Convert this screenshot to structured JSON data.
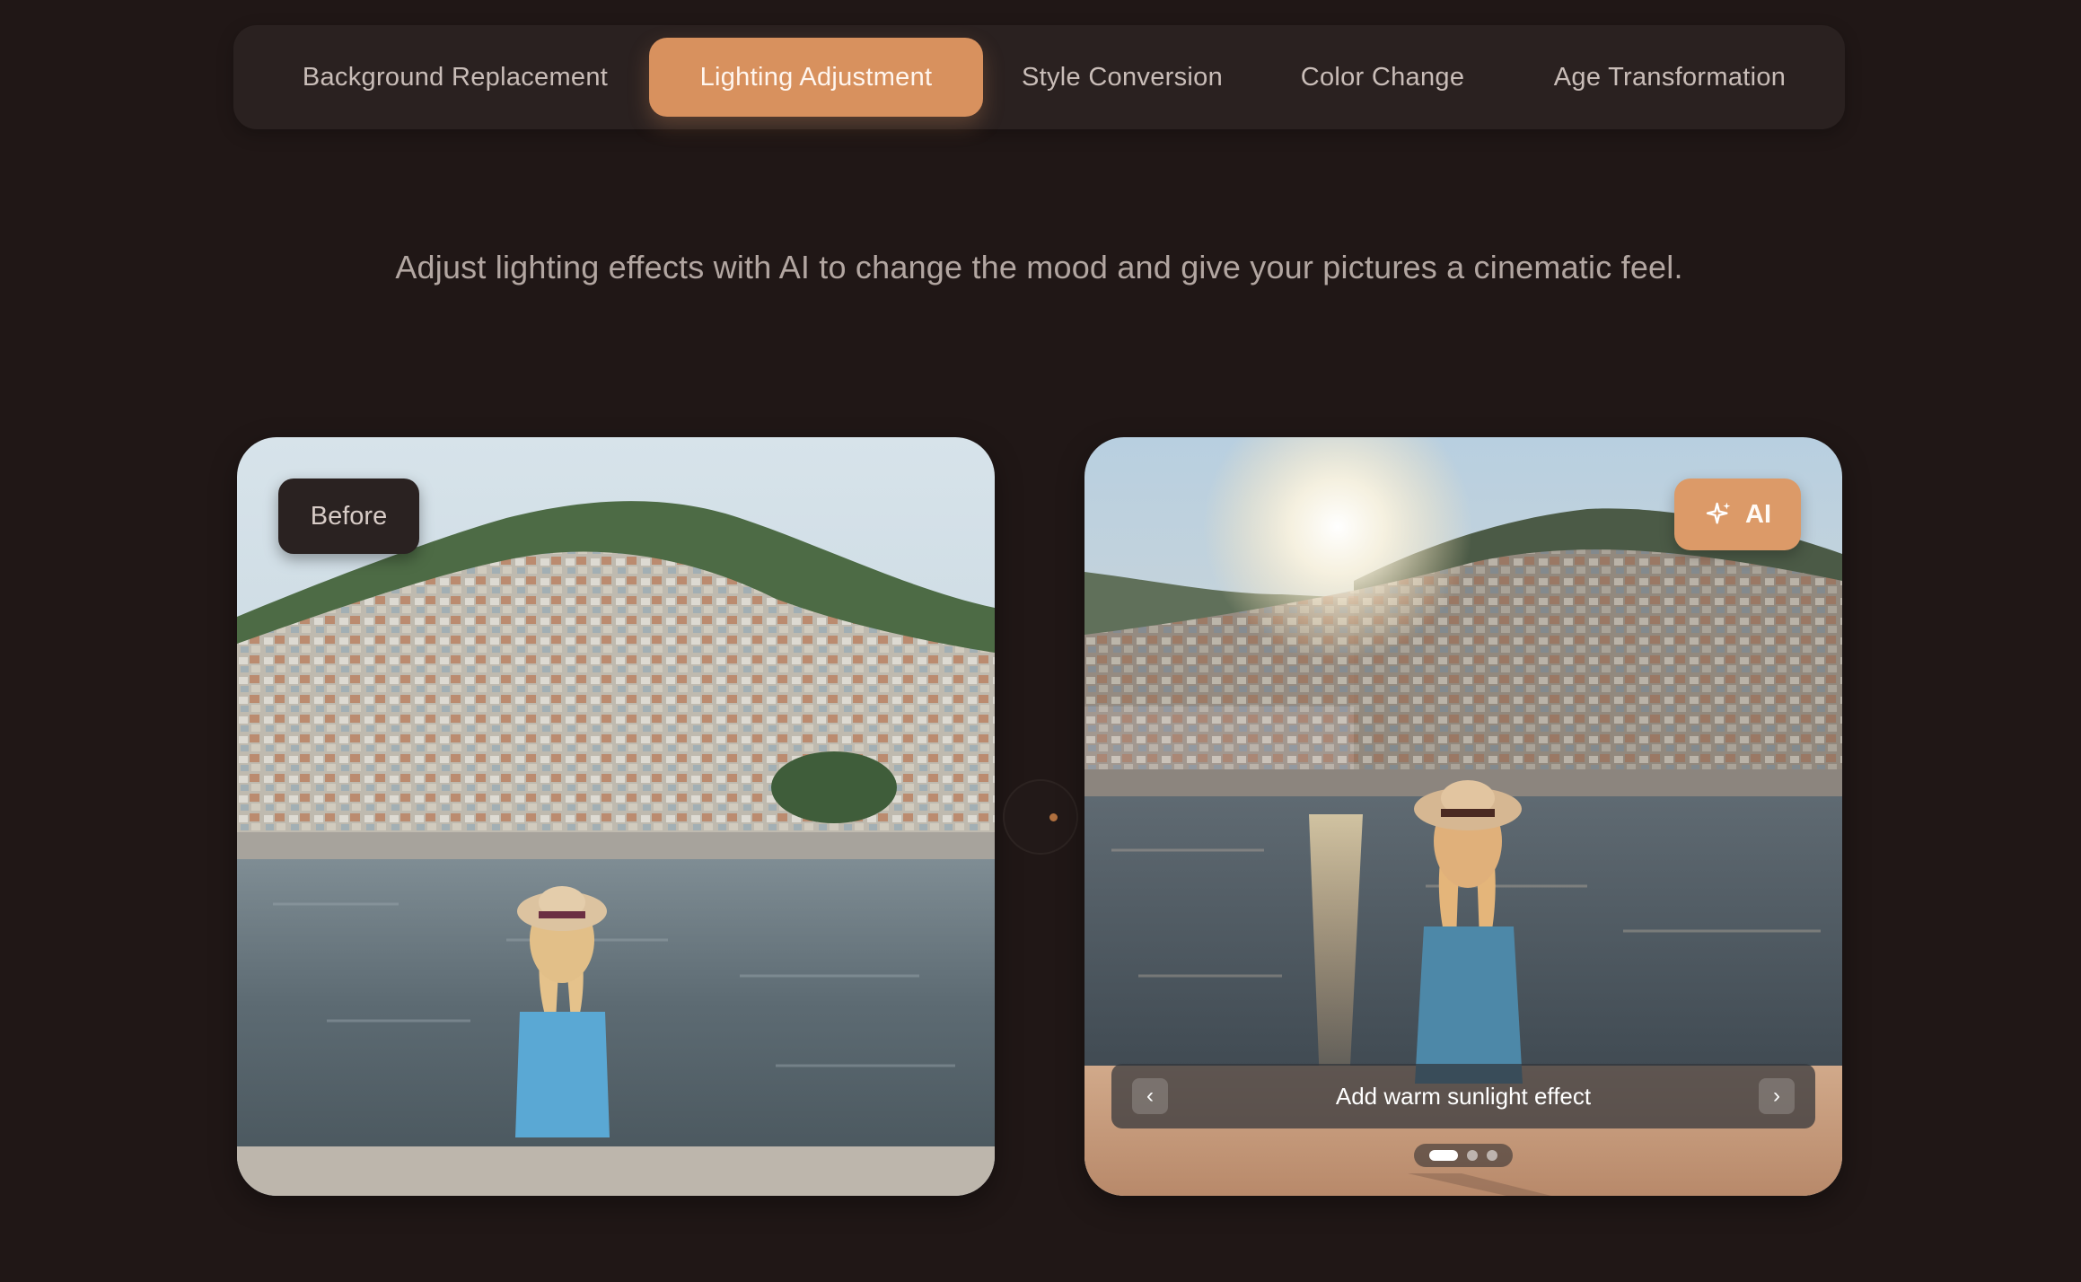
{
  "tabs": [
    {
      "label": "Background Replacement",
      "active": false
    },
    {
      "label": "Lighting Adjustment",
      "active": true
    },
    {
      "label": "Style Conversion",
      "active": false
    },
    {
      "label": "Color Change",
      "active": false
    },
    {
      "label": "Age Transformation",
      "active": false
    }
  ],
  "description": "Adjust lighting effects with AI to change the mood and give your pictures a cinematic feel.",
  "before_card": {
    "badge": "Before"
  },
  "after_card": {
    "badge": "AI",
    "badge_icon": "sparkle-icon",
    "caption": "Add warm sunlight effect",
    "prev_icon": "chevron-left-icon",
    "next_icon": "chevron-right-icon",
    "slide_count": 3,
    "active_slide": 1
  },
  "colors": {
    "background": "#201716",
    "accent": "#d8915e",
    "tab_bar": "#2a2120",
    "text_muted": "#b2a6a1"
  }
}
